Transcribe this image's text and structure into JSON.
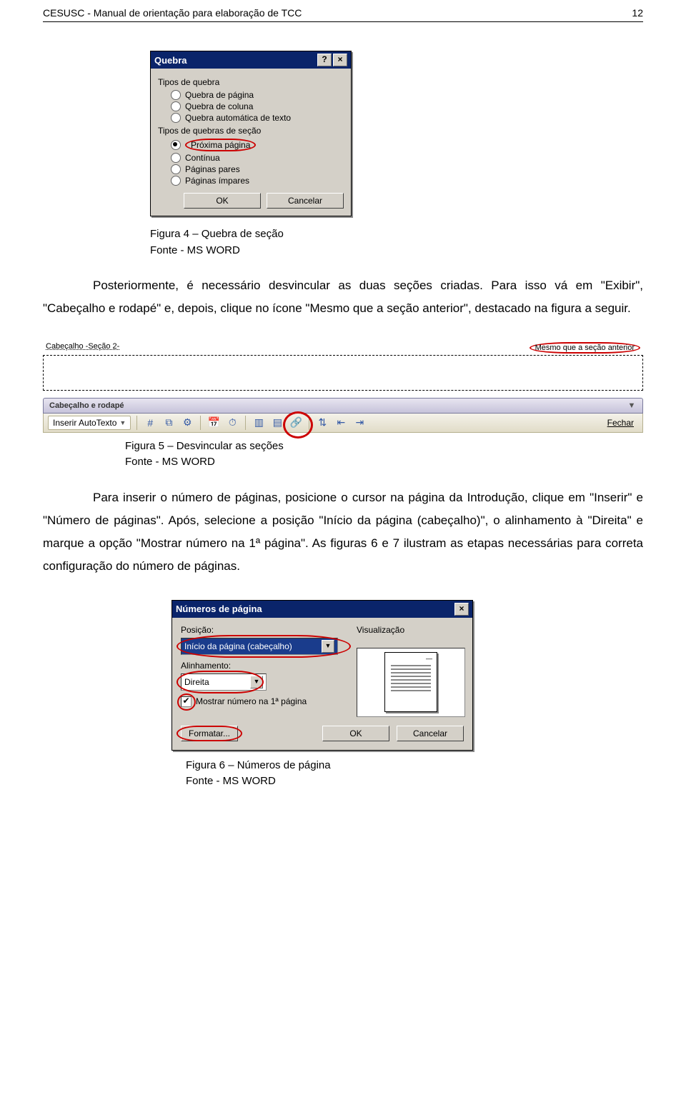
{
  "header": {
    "title": "CESUSC - Manual de orientação para elaboração de TCC",
    "page_number": "12"
  },
  "dialog1": {
    "title": "Quebra",
    "help_btn": "?",
    "close_btn": "×",
    "group1_label": "Tipos de quebra",
    "opt_page": "Quebra de página",
    "opt_column": "Quebra de coluna",
    "opt_textwrap": "Quebra automática de texto",
    "group2_label": "Tipos de quebras de seção",
    "opt_nextpage": "Próxima página",
    "opt_continuous": "Contínua",
    "opt_even": "Páginas pares",
    "opt_odd": "Páginas ímpares",
    "ok": "OK",
    "cancel": "Cancelar"
  },
  "caption1": {
    "line1": "Figura 4 – Quebra de seção",
    "line2": "Fonte - MS WORD"
  },
  "para1": "Posteriormente, é necessário desvincular as duas seções criadas. Para isso vá em \"Exibir\", \"Cabeçalho e rodapé\" e, depois, clique no ícone \"Mesmo que a seção anterior\", destacado na figura a seguir.",
  "hf": {
    "left_label": "Cabeçalho -Seção 2-",
    "right_label": "Mesmo que a seção anterior",
    "toolbar_title": "Cabeçalho e rodapé",
    "autotext": "Inserir AutoTexto",
    "close": "Fechar"
  },
  "caption2": {
    "line1": "Figura 5 – Desvincular as seções",
    "line2": "Fonte - MS WORD"
  },
  "para2": "Para inserir o número de páginas, posicione o cursor na página da Introdução, clique em \"Inserir\" e \"Número de páginas\". Após, selecione a posição \"Início da página (cabeçalho)\",  o alinhamento à \"Direita\" e marque a opção \"Mostrar número na 1ª página\". As figuras 6 e 7 ilustram as etapas necessárias para correta configuração do número de páginas.",
  "np": {
    "title": "Números de página",
    "close_btn": "×",
    "pos_label": "Posição:",
    "pos_value": "Início da página (cabeçalho)",
    "align_label": "Alinhamento:",
    "align_value": "Direita",
    "show_first": "Mostrar número na 1ª página",
    "check_glyph": "✔",
    "preview_label": "Visualização",
    "format_btn": "Formatar...",
    "ok": "OK",
    "cancel": "Cancelar"
  },
  "caption3": {
    "line1": "Figura 6 – Números de página",
    "line2": "Fonte - MS WORD"
  }
}
